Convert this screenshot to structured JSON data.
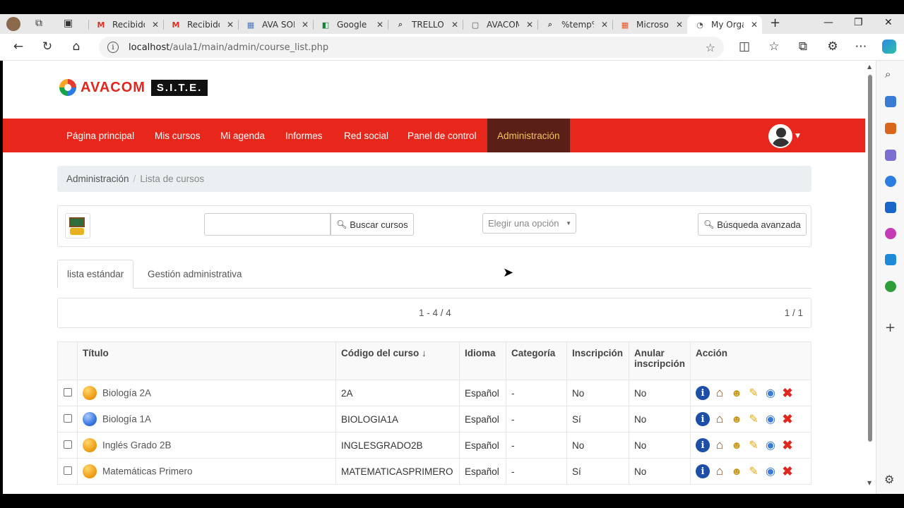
{
  "browser": {
    "tabs": [
      {
        "label": "Recibido",
        "icon": "gmail-icon",
        "glyph": "M",
        "color": "#d93025"
      },
      {
        "label": "Recibido",
        "icon": "gmail-icon",
        "glyph": "M",
        "color": "#d93025"
      },
      {
        "label": "AVA SOL",
        "icon": "document-icon",
        "glyph": "▦",
        "color": "#4a78c2"
      },
      {
        "label": "Google M",
        "icon": "google-meet-icon",
        "glyph": "◧",
        "color": "#188038"
      },
      {
        "label": "TRELLO -",
        "icon": "search-icon",
        "glyph": "⌕",
        "color": "#555"
      },
      {
        "label": "AVACOM",
        "icon": "page-icon",
        "glyph": "▢",
        "color": "#555"
      },
      {
        "label": "%temp%",
        "icon": "search-icon",
        "glyph": "⌕",
        "color": "#555"
      },
      {
        "label": "Microsof",
        "icon": "microsoft-icon",
        "glyph": "▦",
        "color": "#f25022"
      },
      {
        "label": "My Orga",
        "icon": "site-icon",
        "glyph": "◔",
        "color": "#555"
      }
    ],
    "url_host": "localhost",
    "url_path": "/aula1/main/admin/course_list.php"
  },
  "site": {
    "brand": "AVACOM",
    "brand_suffix": "S.I.T.E.",
    "menu": [
      {
        "label": "Página principal"
      },
      {
        "label": "Mis cursos"
      },
      {
        "label": "Mi agenda"
      },
      {
        "label": "Informes"
      },
      {
        "label": "Red social"
      },
      {
        "label": "Panel de control"
      },
      {
        "label": "Administración"
      }
    ],
    "accent": "#e8271c",
    "active_bg": "#5a1f17",
    "active_fg": "#f6c35a"
  },
  "breadcrumb": {
    "root": "Administración",
    "sep": "/",
    "current": "Lista de cursos"
  },
  "toolbar": {
    "search_value": "",
    "search_button": "Buscar cursos",
    "select_value": "Elegir una opción",
    "advanced_button": "Búsqueda avanzada"
  },
  "tabs": {
    "standard": "lista estándar",
    "admin": "Gestión administrativa"
  },
  "pager": {
    "range": "1 - 4 / 4",
    "pages": "1 / 1"
  },
  "table": {
    "headers": {
      "title": "Título",
      "code": "Código del curso ↓",
      "language": "Idioma",
      "category": "Categoría",
      "enroll": "Inscripción",
      "unenroll1": "Anular",
      "unenroll2": "inscripción",
      "action": "Acción"
    },
    "rows": [
      {
        "title": "Biología 2A",
        "code": "2A",
        "language": "Español",
        "category": "-",
        "enroll": "No",
        "unenroll": "No",
        "dot": "orange"
      },
      {
        "title": "Biología 1A",
        "code": "BIOLOGIA1A",
        "language": "Español",
        "category": "-",
        "enroll": "Sí",
        "unenroll": "No",
        "dot": "blue"
      },
      {
        "title": "Inglés Grado 2B",
        "code": "INGLESGRADO2B",
        "language": "Español",
        "category": "-",
        "enroll": "No",
        "unenroll": "No",
        "dot": "orange"
      },
      {
        "title": "Matemáticas Primero",
        "code": "MATEMATICASPRIMERO",
        "language": "Español",
        "category": "-",
        "enroll": "Sí",
        "unenroll": "No",
        "dot": "orange"
      }
    ]
  }
}
